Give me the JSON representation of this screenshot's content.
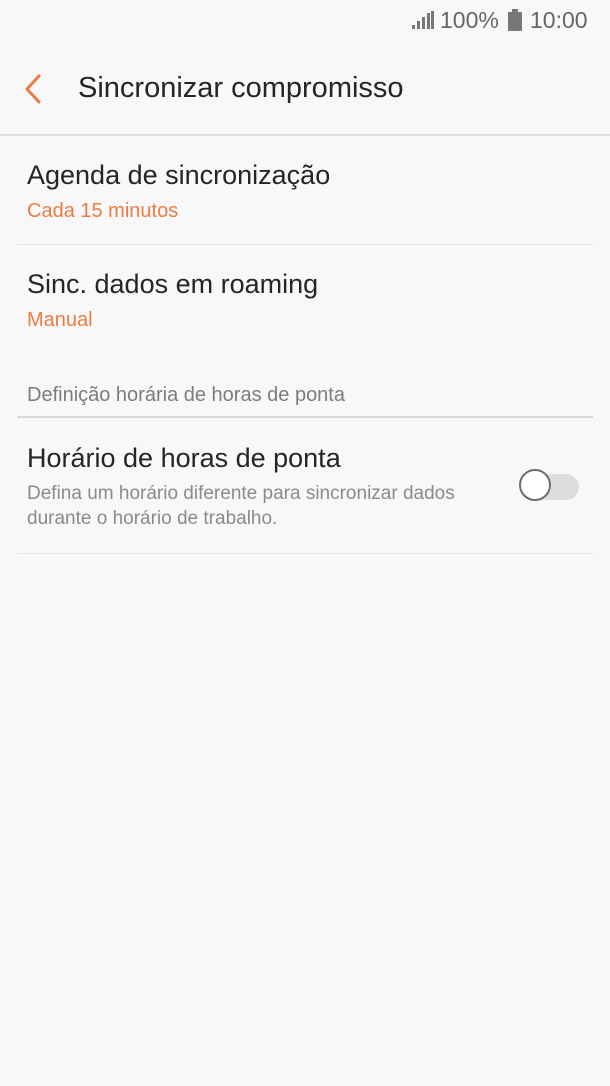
{
  "status_bar": {
    "battery_percent": "100%",
    "time": "10:00",
    "signal_icon": "signal-bars-icon",
    "battery_icon": "battery-full-icon"
  },
  "header": {
    "back_icon": "chevron-left-icon",
    "title": "Sincronizar compromisso",
    "accent_color": "#ee7b43"
  },
  "settings": {
    "agenda": {
      "title": "Agenda de sincronização",
      "value": "Cada 15 minutos"
    },
    "roaming": {
      "title": "Sinc. dados em roaming",
      "value": "Manual"
    },
    "section_label": "Definição horária de horas de ponta",
    "peak": {
      "title": "Horário de horas de ponta",
      "description": "Defina um horário diferente para sincronizar dados durante o horário de trabalho.",
      "enabled": false
    }
  }
}
